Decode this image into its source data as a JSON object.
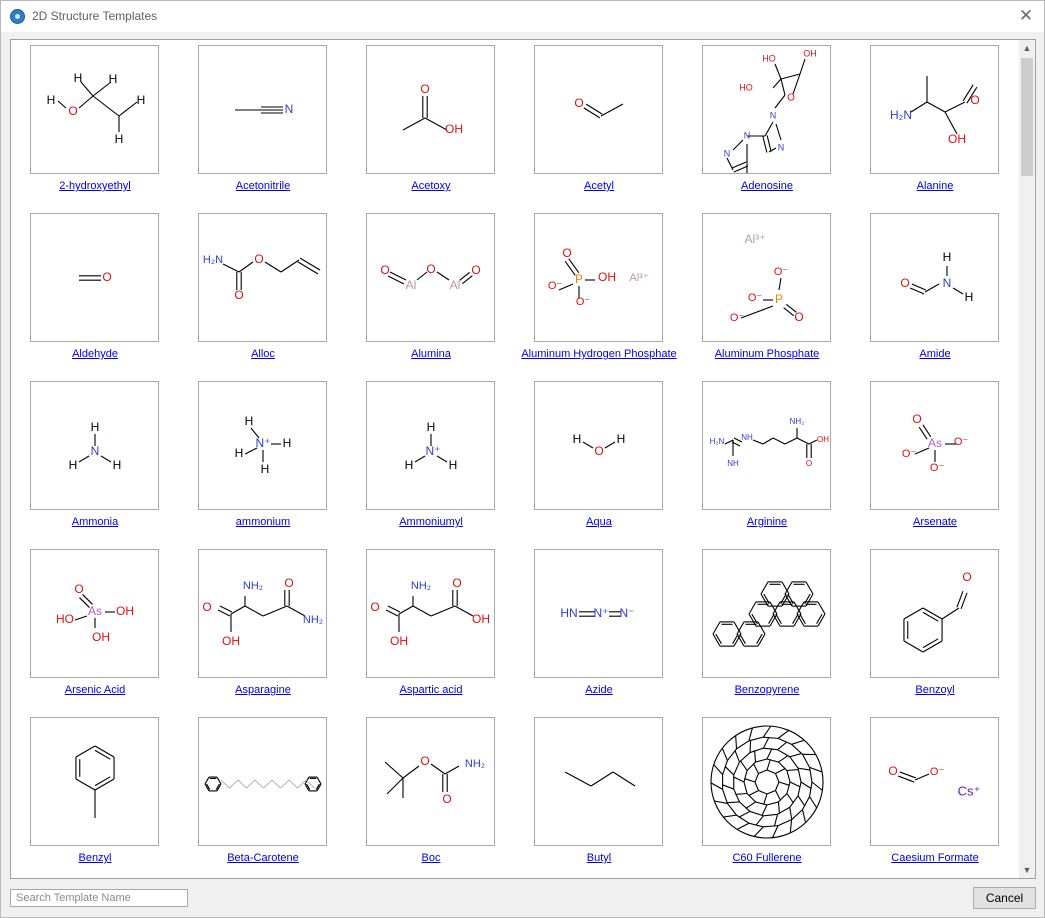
{
  "window": {
    "title": "2D Structure Templates",
    "close_icon": "close-icon"
  },
  "templates": [
    {
      "name": "2-hydroxyethyl",
      "slug": "2-hydroxyethyl"
    },
    {
      "name": "Acetonitrile",
      "slug": "acetonitrile"
    },
    {
      "name": "Acetoxy",
      "slug": "acetoxy"
    },
    {
      "name": "Acetyl",
      "slug": "acetyl"
    },
    {
      "name": "Adenosine",
      "slug": "adenosine"
    },
    {
      "name": "Alanine",
      "slug": "alanine"
    },
    {
      "name": "Aldehyde",
      "slug": "aldehyde"
    },
    {
      "name": "Alloc",
      "slug": "alloc"
    },
    {
      "name": "Alumina",
      "slug": "alumina"
    },
    {
      "name": "Aluminum Hydrogen Phosphate",
      "slug": "aluminum-hydrogen-phosphate"
    },
    {
      "name": "Aluminum Phosphate",
      "slug": "aluminum-phosphate"
    },
    {
      "name": "Amide",
      "slug": "amide"
    },
    {
      "name": "Ammonia",
      "slug": "ammonia"
    },
    {
      "name": "ammonium",
      "slug": "ammonium"
    },
    {
      "name": "Ammoniumyl",
      "slug": "ammoniumyl"
    },
    {
      "name": "Aqua",
      "slug": "aqua"
    },
    {
      "name": "Arginine",
      "slug": "arginine"
    },
    {
      "name": "Arsenate",
      "slug": "arsenate"
    },
    {
      "name": "Arsenic Acid",
      "slug": "arsenic-acid"
    },
    {
      "name": "Asparagine",
      "slug": "asparagine"
    },
    {
      "name": "Aspartic acid",
      "slug": "aspartic-acid"
    },
    {
      "name": "Azide",
      "slug": "azide"
    },
    {
      "name": "Benzopyrene",
      "slug": "benzopyrene"
    },
    {
      "name": "Benzoyl",
      "slug": "benzoyl"
    },
    {
      "name": "Benzyl",
      "slug": "benzyl"
    },
    {
      "name": "Beta-Carotene",
      "slug": "beta-carotene"
    },
    {
      "name": "Boc",
      "slug": "boc"
    },
    {
      "name": "Butyl",
      "slug": "butyl"
    },
    {
      "name": "C60 Fullerene",
      "slug": "c60-fullerene"
    },
    {
      "name": "Caesium Formate",
      "slug": "caesium-formate"
    }
  ],
  "structure_text": {
    "H": "H",
    "O": "O",
    "N": "N",
    "OH": "OH",
    "HO": "HO",
    "H2N": "H₂N",
    "NH2": "NH₂",
    "Al": "Al",
    "Al3": "Al³⁺",
    "P": "P",
    "As": "As",
    "Om": "O⁻",
    "Np": "N⁺",
    "Nm": "N⁻",
    "HN": "HN",
    "NH": "NH",
    "Cs": "Cs⁺"
  },
  "search": {
    "placeholder": "Search Template Name",
    "value": ""
  },
  "buttons": {
    "cancel": "Cancel"
  },
  "scrollbar": {
    "up_icon": "scroll-up-arrow-icon",
    "down_icon": "scroll-down-arrow-icon"
  },
  "colors": {
    "link": "#0000ee",
    "oxygen": "#e01010",
    "nitrogen": "#2a3fd6",
    "phosphorus": "#e08c00",
    "arsenic": "#b05cc4",
    "aluminum": "#b59a9a",
    "caesium": "#6a1cb0"
  }
}
